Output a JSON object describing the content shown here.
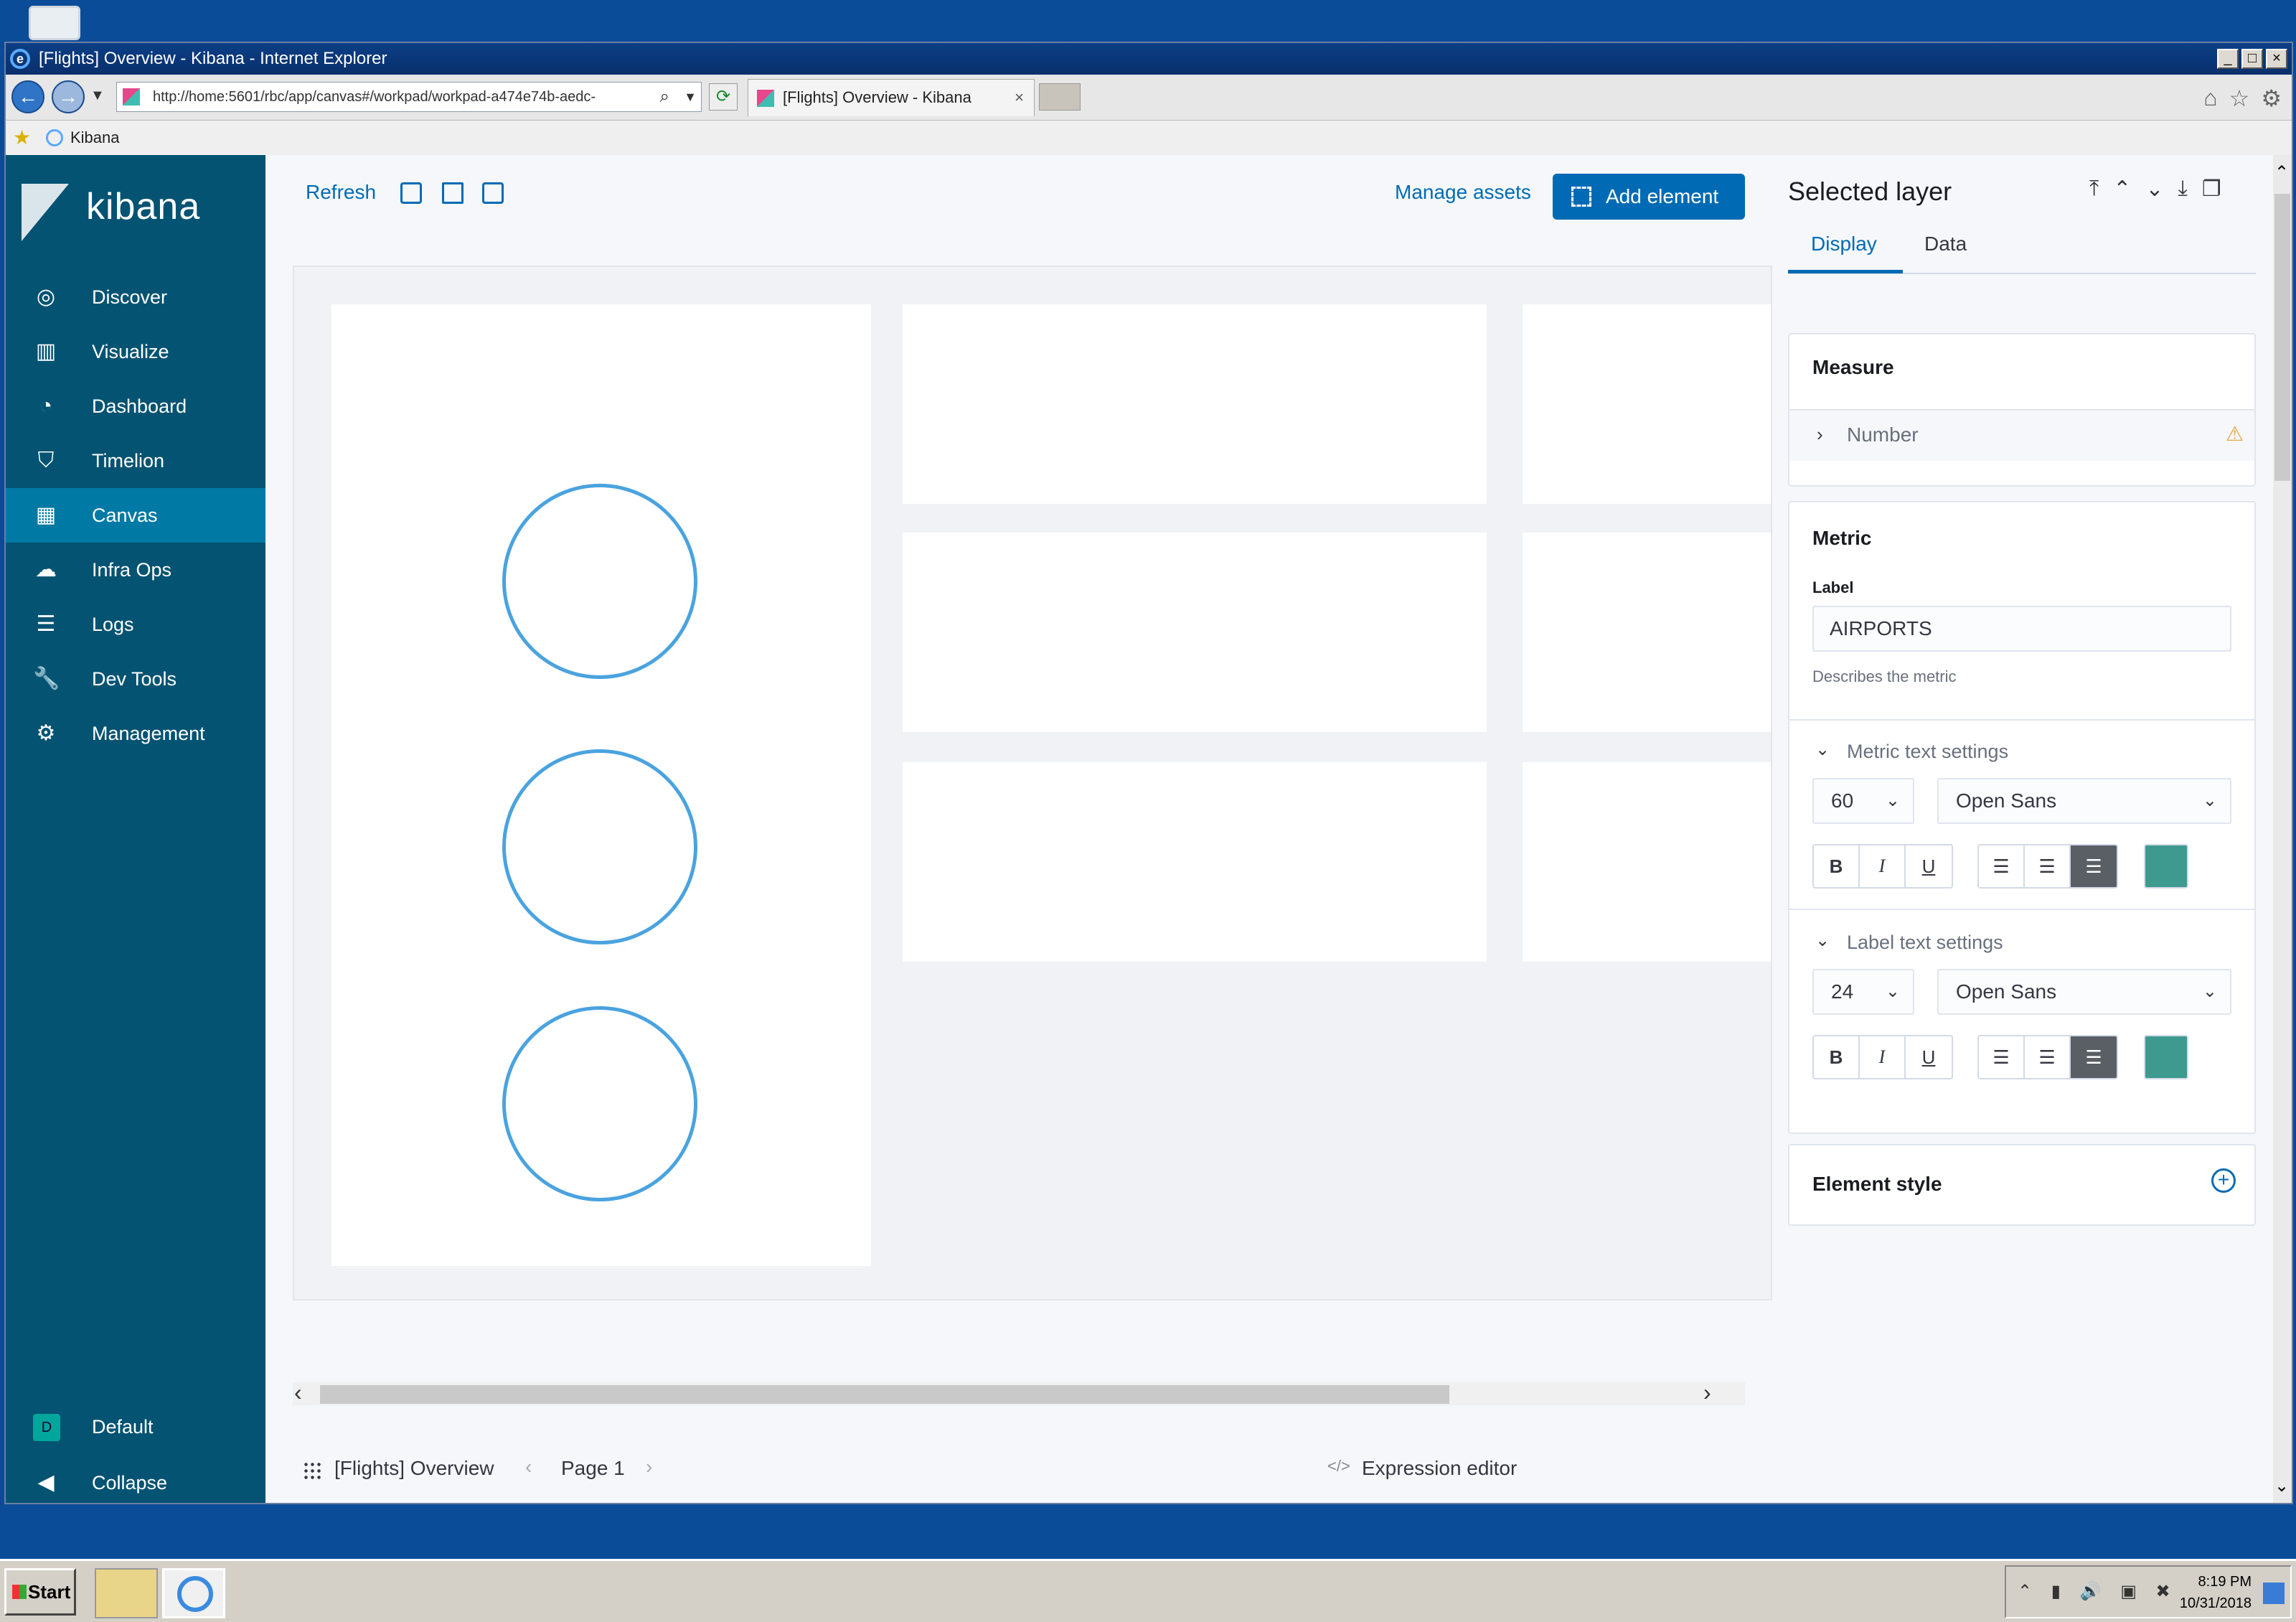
{
  "window": {
    "title": "[Flights] Overview - Kibana - Internet Explorer",
    "address": "http://home:5601/rbc/app/canvas#/workpad/workpad-a474e74b-aedc-",
    "tab_title": "[Flights] Overview - Kibana",
    "favorites_item": "Kibana"
  },
  "sidebar": {
    "brand": "kibana",
    "items": [
      {
        "label": "Discover",
        "icon": "compass-icon"
      },
      {
        "label": "Visualize",
        "icon": "bar-chart-icon"
      },
      {
        "label": "Dashboard",
        "icon": "dashboard-icon"
      },
      {
        "label": "Timelion",
        "icon": "timelion-icon"
      },
      {
        "label": "Canvas",
        "icon": "canvas-icon",
        "active": true
      },
      {
        "label": "Infra Ops",
        "icon": "infra-icon"
      },
      {
        "label": "Logs",
        "icon": "logs-icon"
      },
      {
        "label": "Dev Tools",
        "icon": "wrench-icon"
      },
      {
        "label": "Management",
        "icon": "gear-icon"
      }
    ],
    "space_badge": "D",
    "space_label": "Default",
    "collapse_label": "Collapse"
  },
  "toolbar": {
    "refresh_label": "Refresh",
    "manage_assets_label": "Manage assets",
    "add_element_label": "Add element"
  },
  "footer": {
    "workpad_name": "[Flights] Overview",
    "page_label": "Page 1",
    "expression_editor_label": "Expression editor"
  },
  "panel": {
    "title": "Selected layer",
    "tabs": [
      "Display",
      "Data"
    ],
    "measure": {
      "heading": "Measure",
      "item": "Number"
    },
    "metric": {
      "heading": "Metric",
      "label_caption": "Label",
      "label_value": "AIRPORTS",
      "help": "Describes the metric",
      "metric_text_settings": "Metric text settings",
      "metric_font_size": "60",
      "metric_font": "Open Sans",
      "label_text_settings": "Label text settings",
      "label_font_size": "24",
      "label_font": "Open Sans"
    },
    "element_style_heading": "Element style",
    "accent_color": "#3e9a8f"
  },
  "taskbar": {
    "start_label": "Start",
    "time": "8:19 PM",
    "date": "10/31/2018"
  }
}
